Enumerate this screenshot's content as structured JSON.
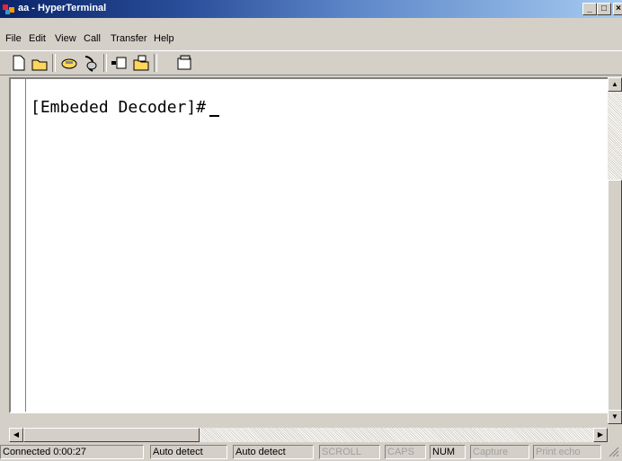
{
  "window": {
    "title": "aa - HyperTerminal"
  },
  "menu": [
    "File",
    "Edit",
    "View",
    "Call",
    "Transfer",
    "Help"
  ],
  "toolbar": {
    "buttons": [
      "new-icon",
      "open-icon",
      "connect-icon",
      "disconnect-icon",
      "send-icon",
      "receive-icon",
      "properties-icon"
    ]
  },
  "terminal": {
    "prompt": "[Embeded Decoder]#"
  },
  "status": {
    "connected": "Connected 0:00:27",
    "detect1": "Auto detect",
    "detect2": "Auto detect",
    "scroll": "SCROLL",
    "caps": "CAPS",
    "num": "NUM",
    "capture": "Capture",
    "print_echo": "Print echo"
  }
}
